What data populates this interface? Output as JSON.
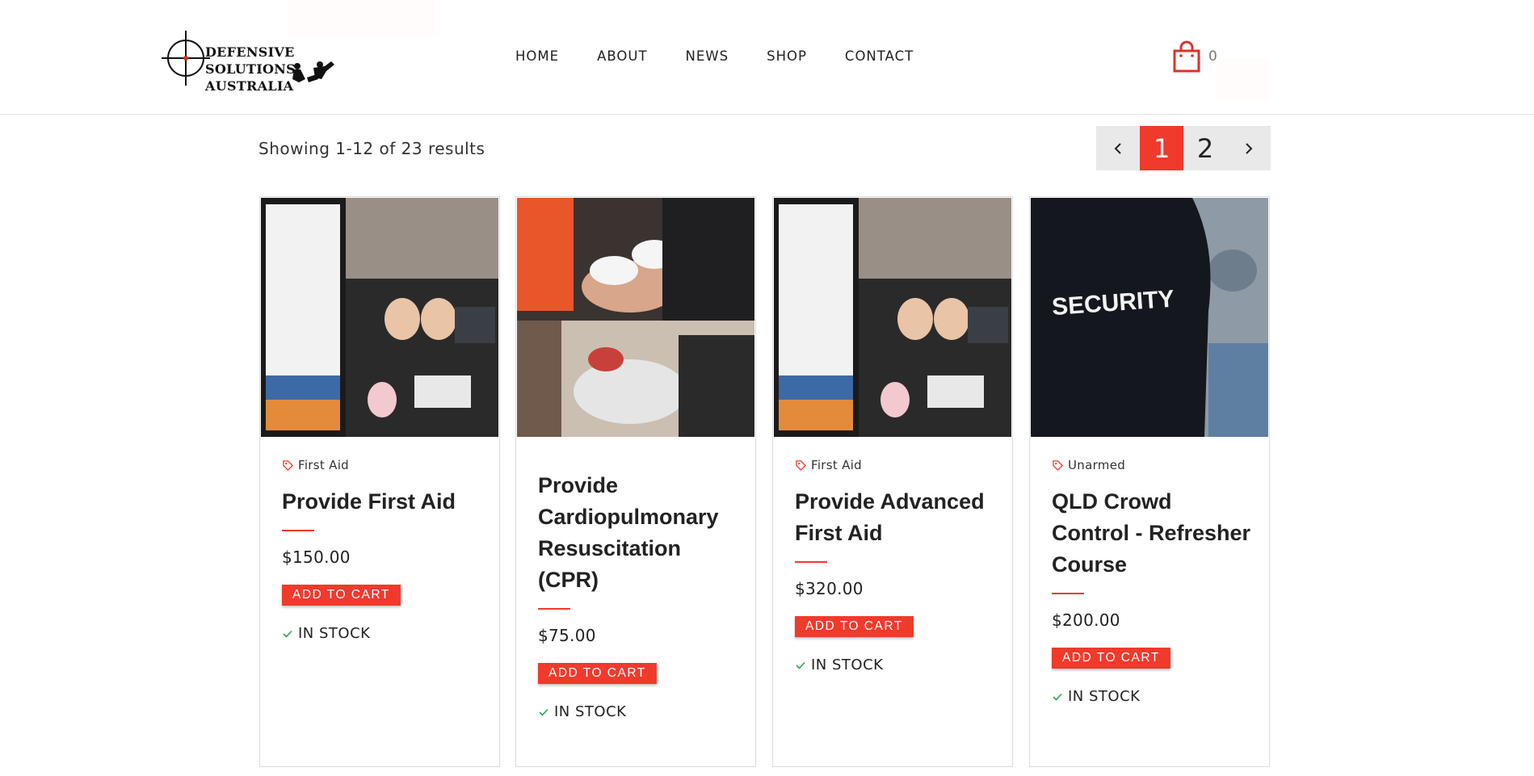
{
  "brand": {
    "logo_line1": "DEFENSIVE SOLUTIONS",
    "logo_line2": "AUSTRALIA"
  },
  "nav": {
    "items": [
      {
        "label": "HOME"
      },
      {
        "label": "ABOUT"
      },
      {
        "label": "NEWS"
      },
      {
        "label": "SHOP"
      },
      {
        "label": "CONTACT"
      }
    ]
  },
  "cart": {
    "icon": "shopping-bag-icon",
    "count": "0"
  },
  "results": {
    "text": "Showing 1-12 of 23 results"
  },
  "pagination": {
    "prev_icon": "chevron-left-icon",
    "pages": [
      "1",
      "2"
    ],
    "current": "1",
    "next_icon": "chevron-right-icon"
  },
  "colors": {
    "accent": "#f03a2c",
    "stock_check": "#2ea44f"
  },
  "products": [
    {
      "category": "First Aid",
      "title": "Provide First Aid",
      "price": "$150.00",
      "cta": "ADD TO CART",
      "stock": "IN STOCK"
    },
    {
      "category": "",
      "title": "Provide Cardiopulmonary Resuscitation (CPR)",
      "price": "$75.00",
      "cta": "ADD TO CART",
      "stock": "IN STOCK"
    },
    {
      "category": "First Aid",
      "title": "Provide Advanced First Aid",
      "price": "$320.00",
      "cta": "ADD TO CART",
      "stock": "IN STOCK"
    },
    {
      "category": "Unarmed",
      "title": "QLD Crowd Control - Refresher Course",
      "price": "$200.00",
      "cta": "ADD TO CART",
      "stock": "IN STOCK"
    }
  ]
}
